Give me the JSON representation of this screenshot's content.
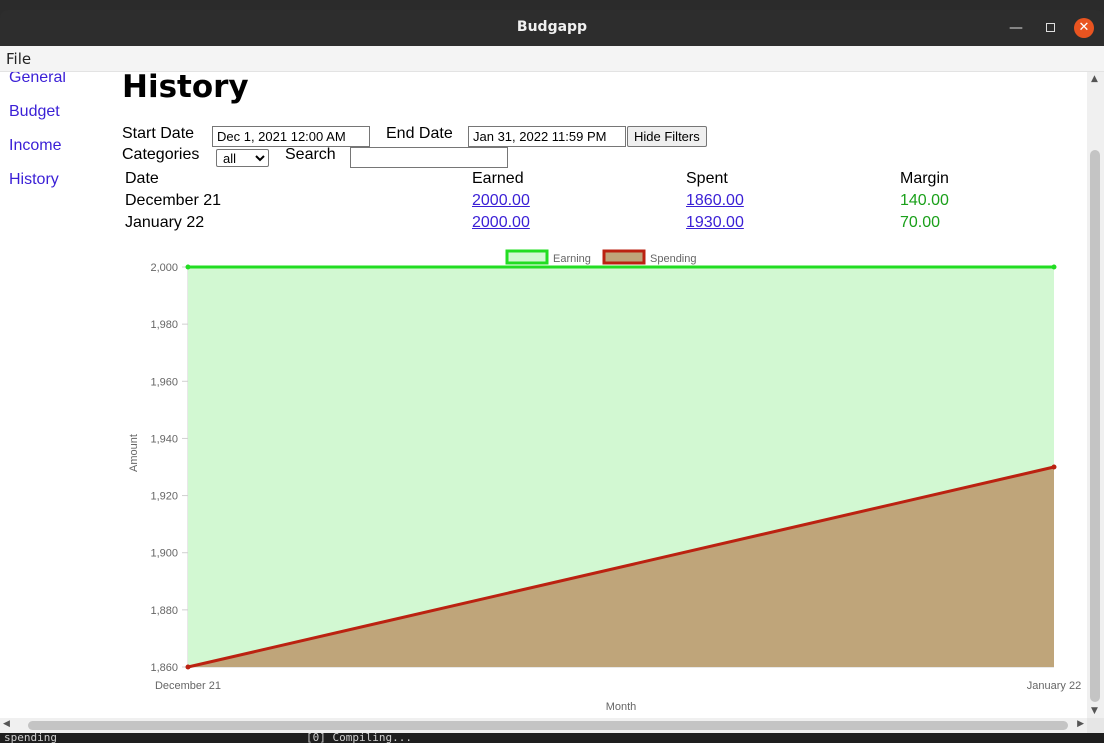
{
  "window": {
    "title": "Budgapp"
  },
  "menu": {
    "file": "File"
  },
  "nav": [
    {
      "label": "General"
    },
    {
      "label": "Budget"
    },
    {
      "label": "Income"
    },
    {
      "label": "History"
    }
  ],
  "page": {
    "title": "History"
  },
  "filters": {
    "start_label": "Start Date",
    "start_value": "Dec 1, 2021 12:00 AM",
    "end_label": "End Date",
    "end_value": "Jan 31, 2022 11:59 PM",
    "hide_button": "Hide Filters",
    "categories_label": "Categories",
    "categories_selected": "all",
    "search_label": "Search",
    "search_value": ""
  },
  "table": {
    "headers": [
      "Date",
      "Earned",
      "Spent",
      "Margin"
    ],
    "rows": [
      {
        "date": "December 21",
        "earned": "2000.00",
        "spent": "1860.00",
        "margin": "140.00"
      },
      {
        "date": "January 22",
        "earned": "2000.00",
        "spent": "1930.00",
        "margin": "70.00"
      }
    ]
  },
  "terminal": {
    "left": "spending",
    "right": "[0] Compiling..."
  },
  "colors": {
    "link": "#3a1fd6",
    "margin_positive": "#1aa01a",
    "earning_line": "#22dd22",
    "earning_fill": "#d2f8d2",
    "spending_line": "#bb2211",
    "spending_fill": "#bfa57a"
  },
  "chart_data": {
    "type": "area",
    "categories": [
      "December 21",
      "January 22"
    ],
    "series": [
      {
        "name": "Earning",
        "values": [
          2000,
          2000
        ]
      },
      {
        "name": "Spending",
        "values": [
          1860,
          1930
        ]
      }
    ],
    "xlabel": "Month",
    "ylabel": "Amount",
    "ylim": [
      1860,
      2000
    ],
    "yticks": [
      "1,860",
      "1,880",
      "1,900",
      "1,920",
      "1,940",
      "1,960",
      "1,980",
      "2,000"
    ],
    "grid": true,
    "legend": "top"
  }
}
